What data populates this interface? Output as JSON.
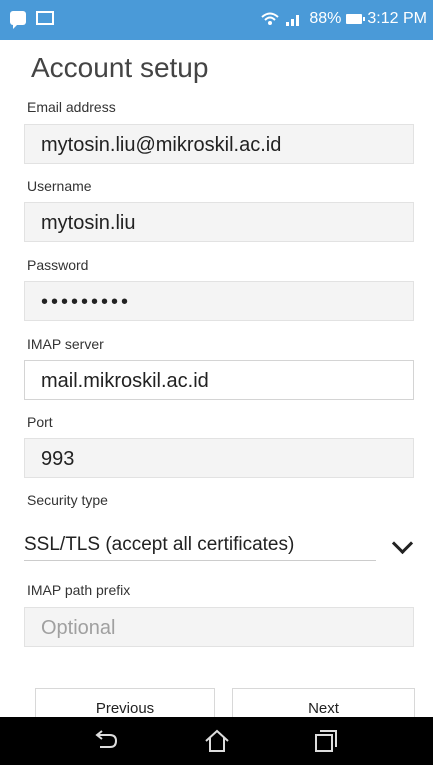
{
  "status_bar": {
    "battery": "88%",
    "time": "3:12 PM",
    "icons": [
      "message-icon",
      "mail-icon",
      "wifi-icon",
      "signal-icon",
      "battery-icon"
    ]
  },
  "screen": {
    "title": "Account setup"
  },
  "form": {
    "email": {
      "label": "Email address",
      "value": "mytosin.liu@mikroskil.ac.id"
    },
    "username": {
      "label": "Username",
      "value": "mytosin.liu"
    },
    "password": {
      "label": "Password",
      "value": "•••••••••"
    },
    "imap_server": {
      "label": "IMAP server",
      "value": "mail.mikroskil.ac.id"
    },
    "port": {
      "label": "Port",
      "value": "993"
    },
    "security": {
      "label": "Security type",
      "value": "SSL/TLS (accept all certificates)"
    },
    "imap_prefix": {
      "label": "IMAP path prefix",
      "placeholder": "Optional"
    }
  },
  "buttons": {
    "previous": "Previous",
    "next": "Next"
  },
  "nav_bar": {
    "icons": [
      "back-icon",
      "home-icon",
      "recents-icon"
    ]
  }
}
